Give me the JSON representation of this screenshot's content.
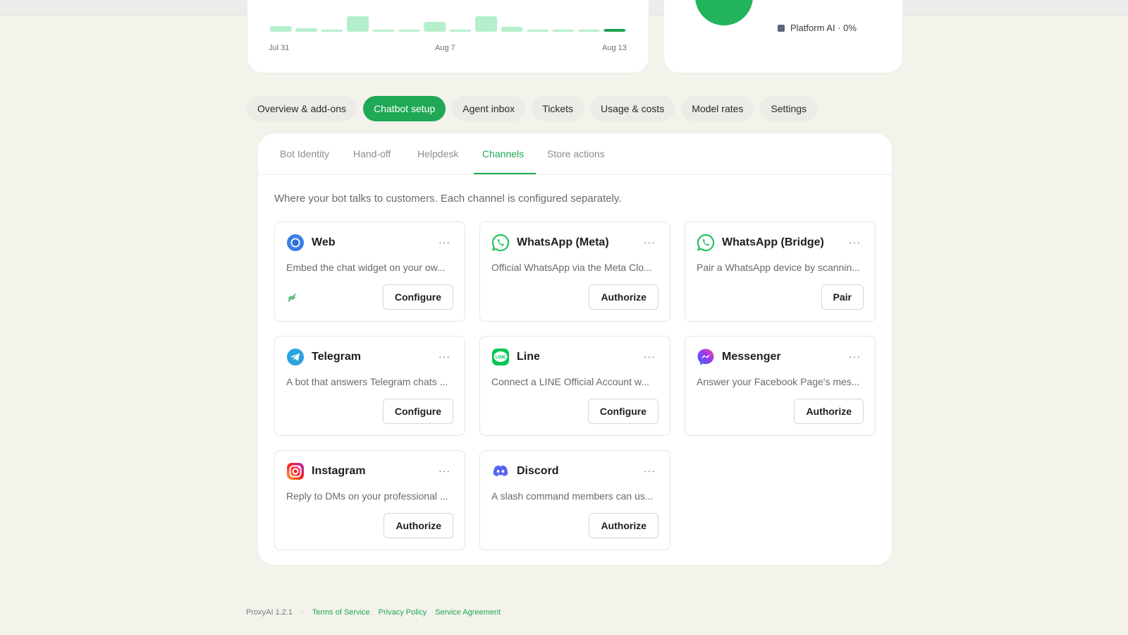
{
  "usage_chart": {
    "xticks": [
      "Jul 31",
      "Aug 7",
      "Aug 13"
    ]
  },
  "chart_data": {
    "type": "bar",
    "categories": [
      "Jul 31",
      "Aug 1",
      "Aug 2",
      "Aug 3",
      "Aug 4",
      "Aug 5",
      "Aug 6",
      "Aug 7",
      "Aug 8",
      "Aug 9",
      "Aug 10",
      "Aug 11",
      "Aug 12",
      "Aug 13"
    ],
    "values": [
      8,
      5,
      3,
      22,
      3,
      3,
      14,
      3,
      22,
      7,
      3,
      3,
      3,
      4
    ],
    "xlabel": "",
    "ylabel": "",
    "grid": false
  },
  "cost_breakdown": {
    "legend": [
      {
        "label": "Platform AI · 0%",
        "color": "#5c6778"
      }
    ]
  },
  "colors": {
    "accent": "#1fa855",
    "bar": "#b6efcb",
    "bar_current": "#20a14f"
  },
  "tabs": [
    {
      "label": "Overview & add-ons"
    },
    {
      "label": "Chatbot setup",
      "active": true
    },
    {
      "label": "Agent inbox"
    },
    {
      "label": "Tickets"
    },
    {
      "label": "Usage & costs"
    },
    {
      "label": "Model rates"
    },
    {
      "label": "Settings"
    }
  ],
  "subtabs": [
    "Bot Identity",
    "Hand-off",
    "Helpdesk",
    "Channels",
    "Store actions"
  ],
  "active_subtab": "Channels",
  "channels_description": "Where your bot talks to customers. Each channel is configured separately.",
  "channels": [
    {
      "name": "Web",
      "icon": "chrome-icon",
      "desc": "Embed the chat widget on your ow...",
      "button": "Configure",
      "status_icon": "link-off-icon"
    },
    {
      "name": "WhatsApp (Meta)",
      "icon": "whatsapp-icon",
      "desc": "Official WhatsApp via the Meta Clo...",
      "button": "Authorize"
    },
    {
      "name": "WhatsApp (Bridge)",
      "icon": "whatsapp-icon",
      "desc": "Pair a WhatsApp device by scannin...",
      "button": "Pair"
    },
    {
      "name": "Telegram",
      "icon": "telegram-icon",
      "desc": "A bot that answers Telegram chats ...",
      "button": "Configure"
    },
    {
      "name": "Line",
      "icon": "line-icon",
      "desc": "Connect a LINE Official Account w...",
      "button": "Configure"
    },
    {
      "name": "Messenger",
      "icon": "messenger-icon",
      "desc": "Answer your Facebook Page's mes...",
      "button": "Authorize"
    },
    {
      "name": "Instagram",
      "icon": "instagram-icon",
      "desc": "Reply to DMs on your professional ...",
      "button": "Authorize"
    },
    {
      "name": "Discord",
      "icon": "discord-icon",
      "desc": "A slash command members can us...",
      "button": "Authorize"
    }
  ],
  "more_label": "···",
  "line_icon_text": "LINE",
  "footer": {
    "version": "ProxyAI 1.2.1",
    "separator": "·",
    "links": [
      "Terms of Service",
      "Privacy Policy",
      "Service Agreement"
    ]
  }
}
